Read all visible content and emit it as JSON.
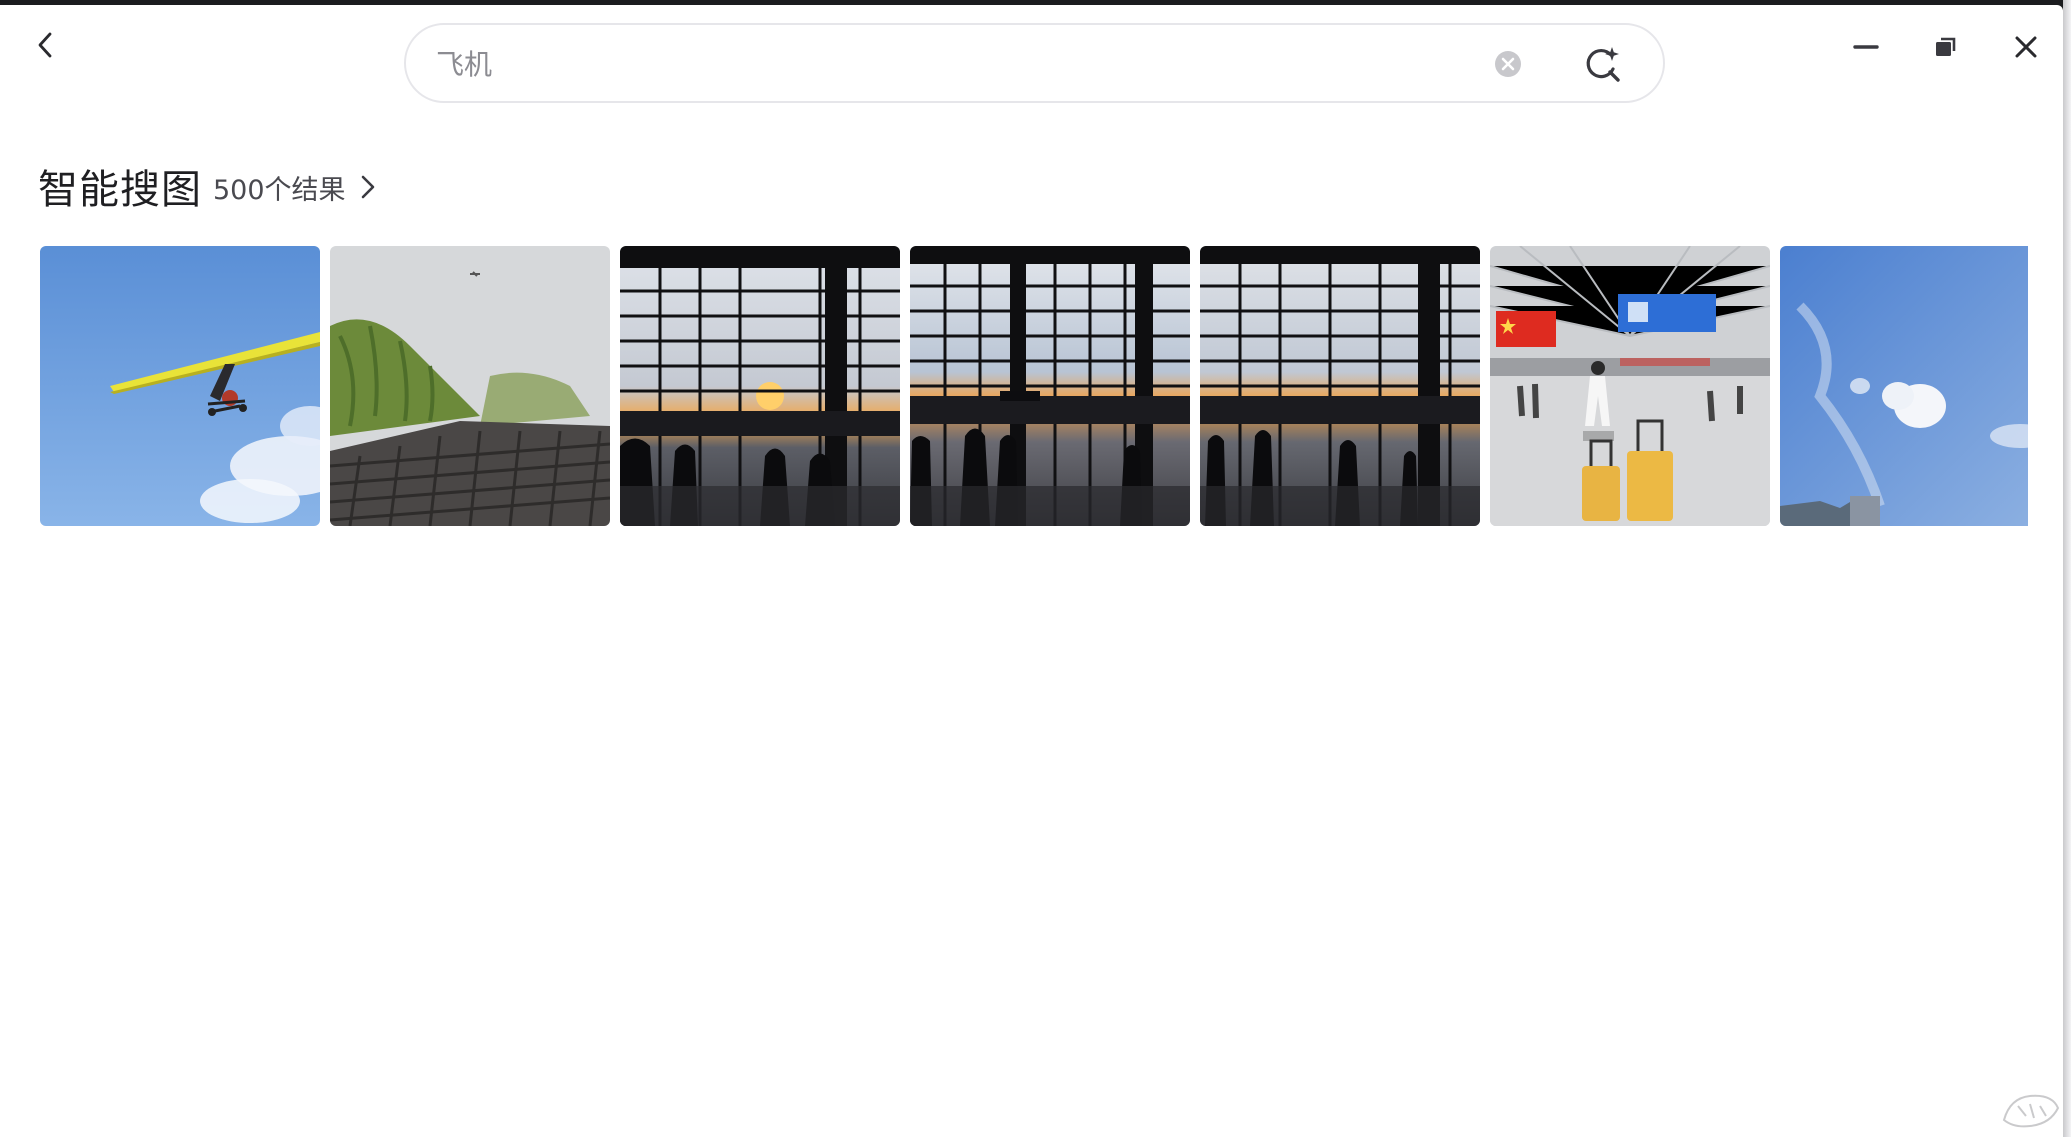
{
  "window": {
    "search": {
      "query": "飞机",
      "clear_icon": "clear-circle-icon",
      "ai_search_icon": "sparkle-search-icon"
    },
    "controls": {
      "back_icon": "chevron-left-icon",
      "minimize_icon": "minimize-icon",
      "restore_icon": "restore-icon",
      "close_icon": "close-icon"
    }
  },
  "section": {
    "title": "智能搜图",
    "result_count": "500个结果",
    "more_icon": "chevron-right-icon"
  },
  "thumbnails": [
    {
      "subject": "ultralight-trike-sky"
    },
    {
      "subject": "willow-roof-plane"
    },
    {
      "subject": "terminal-sunset-1"
    },
    {
      "subject": "terminal-sunset-2"
    },
    {
      "subject": "terminal-sunset-3"
    },
    {
      "subject": "airport-hall-luggage"
    },
    {
      "subject": "blue-sky-clouds"
    }
  ],
  "colors": {
    "background": "#ffffff",
    "text_primary": "#1f1f22",
    "text_secondary": "#4a4a50",
    "search_border": "#e6e6ea"
  }
}
